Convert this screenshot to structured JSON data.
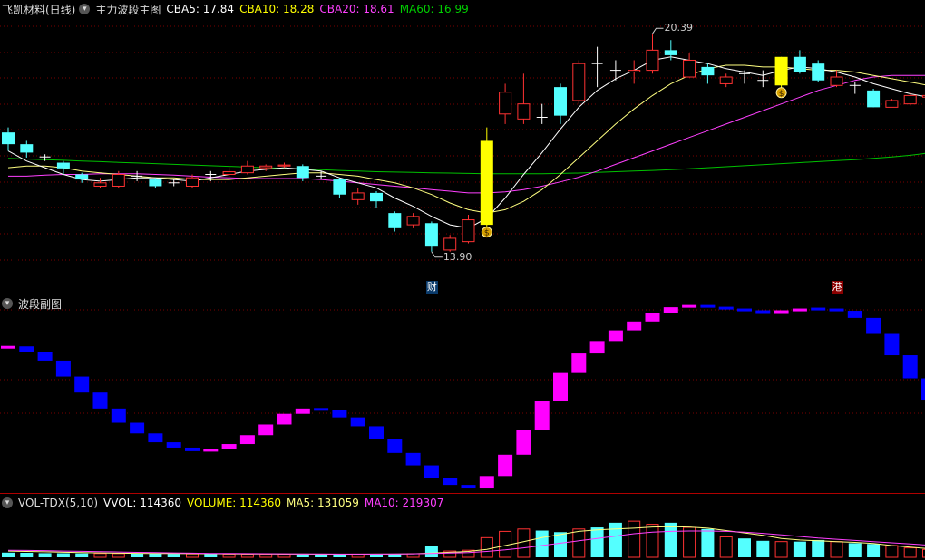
{
  "main_header": {
    "title": "飞凯材料(日线)",
    "indicator_name": "主力波段主图",
    "cba5": "CBA5: 17.84",
    "cba10": "CBA10: 18.28",
    "cba20": "CBA20: 18.61",
    "ma60": "MA60: 16.99"
  },
  "sub_header": {
    "title": "波段副图"
  },
  "vol_header": {
    "title": "VOL-TDX(5,10)",
    "vvol": "VVOL: 114360",
    "volume": "VOLUME: 114360",
    "ma5": "MA5: 131059",
    "ma10": "MA10: 219307"
  },
  "annotations": {
    "high_label": "20.39",
    "low_label": "13.90",
    "tag_cai": "财",
    "tag_gang": "港",
    "money_icon": "$"
  },
  "colors": {
    "up": "#ff3232",
    "down": "#54ffff",
    "signal": "#ffff00",
    "ma5": "#ffffff",
    "ma10": "#ffff80",
    "ma20": "#ff40ff",
    "ma60": "#00c000",
    "wave_up": "#ff00ff",
    "wave_down": "#0000ff",
    "grid": "#7a0000"
  },
  "chart_data": [
    {
      "type": "candlestick",
      "ylim": [
        13.3,
        20.8
      ],
      "candles": [
        {
          "o": 17.1,
          "c": 17.45,
          "h": 17.6,
          "l": 16.9,
          "k": "down"
        },
        {
          "o": 17.1,
          "c": 16.85,
          "h": 17.2,
          "l": 16.7,
          "k": "down"
        },
        {
          "o": 16.72,
          "c": 16.72,
          "h": 16.8,
          "l": 16.6,
          "k": "cross"
        },
        {
          "o": 16.55,
          "c": 16.38,
          "h": 16.6,
          "l": 16.2,
          "k": "down"
        },
        {
          "o": 16.2,
          "c": 16.05,
          "h": 16.25,
          "l": 15.95,
          "k": "down"
        },
        {
          "o": 15.95,
          "c": 15.85,
          "h": 16.1,
          "l": 15.8,
          "k": "up"
        },
        {
          "o": 15.85,
          "c": 16.2,
          "h": 16.3,
          "l": 15.8,
          "k": "up"
        },
        {
          "o": 16.15,
          "c": 16.15,
          "h": 16.3,
          "l": 16.0,
          "k": "cross"
        },
        {
          "o": 16.05,
          "c": 15.85,
          "h": 16.1,
          "l": 15.8,
          "k": "down"
        },
        {
          "o": 15.95,
          "c": 15.95,
          "h": 16.05,
          "l": 15.85,
          "k": "cross"
        },
        {
          "o": 15.85,
          "c": 16.1,
          "h": 16.2,
          "l": 15.8,
          "k": "up"
        },
        {
          "o": 16.2,
          "c": 16.2,
          "h": 16.3,
          "l": 16.0,
          "k": "cross"
        },
        {
          "o": 16.2,
          "c": 16.28,
          "h": 16.4,
          "l": 16.1,
          "k": "up"
        },
        {
          "o": 16.25,
          "c": 16.45,
          "h": 16.6,
          "l": 16.2,
          "k": "up"
        },
        {
          "o": 16.4,
          "c": 16.45,
          "h": 16.5,
          "l": 16.3,
          "k": "up"
        },
        {
          "o": 16.45,
          "c": 16.48,
          "h": 16.55,
          "l": 16.4,
          "k": "up"
        },
        {
          "o": 16.45,
          "c": 16.1,
          "h": 16.5,
          "l": 16.0,
          "k": "down"
        },
        {
          "o": 16.15,
          "c": 16.15,
          "h": 16.3,
          "l": 16.05,
          "k": "cross"
        },
        {
          "o": 16.05,
          "c": 15.6,
          "h": 16.1,
          "l": 15.5,
          "k": "down"
        },
        {
          "o": 15.45,
          "c": 15.65,
          "h": 15.8,
          "l": 15.3,
          "k": "up"
        },
        {
          "o": 15.65,
          "c": 15.4,
          "h": 15.7,
          "l": 15.2,
          "k": "down"
        },
        {
          "o": 15.05,
          "c": 14.6,
          "h": 15.1,
          "l": 14.5,
          "k": "down"
        },
        {
          "o": 14.7,
          "c": 14.95,
          "h": 15.05,
          "l": 14.6,
          "k": "up"
        },
        {
          "o": 14.75,
          "c": 14.05,
          "h": 14.8,
          "l": 13.9,
          "k": "down"
        },
        {
          "o": 13.95,
          "c": 14.3,
          "h": 14.4,
          "l": 13.9,
          "k": "up"
        },
        {
          "o": 14.2,
          "c": 14.85,
          "h": 15.0,
          "l": 14.15,
          "k": "up"
        },
        {
          "o": 14.7,
          "c": 17.2,
          "h": 17.6,
          "l": 14.65,
          "k": "signal"
        },
        {
          "o": 18.0,
          "c": 18.65,
          "h": 18.9,
          "l": 17.7,
          "k": "up"
        },
        {
          "o": 17.85,
          "c": 18.3,
          "h": 19.2,
          "l": 17.7,
          "k": "up"
        },
        {
          "o": 17.9,
          "c": 17.9,
          "h": 18.3,
          "l": 17.7,
          "k": "cross"
        },
        {
          "o": 18.8,
          "c": 17.95,
          "h": 18.9,
          "l": 17.7,
          "k": "down"
        },
        {
          "o": 18.4,
          "c": 19.5,
          "h": 19.6,
          "l": 18.3,
          "k": "up"
        },
        {
          "o": 19.5,
          "c": 19.5,
          "h": 20.0,
          "l": 18.8,
          "k": "cross"
        },
        {
          "o": 19.3,
          "c": 19.3,
          "h": 19.6,
          "l": 19.0,
          "k": "cross"
        },
        {
          "o": 19.25,
          "c": 19.3,
          "h": 19.6,
          "l": 18.9,
          "k": "up"
        },
        {
          "o": 19.3,
          "c": 19.9,
          "h": 20.39,
          "l": 19.2,
          "k": "up"
        },
        {
          "o": 19.9,
          "c": 19.75,
          "h": 20.2,
          "l": 19.6,
          "k": "down"
        },
        {
          "o": 19.6,
          "c": 19.1,
          "h": 19.8,
          "l": 19.1,
          "k": "up"
        },
        {
          "o": 19.4,
          "c": 19.15,
          "h": 19.5,
          "l": 18.9,
          "k": "down"
        },
        {
          "o": 19.1,
          "c": 18.9,
          "h": 19.2,
          "l": 18.8,
          "k": "up"
        },
        {
          "o": 19.2,
          "c": 19.2,
          "h": 19.3,
          "l": 18.9,
          "k": "cross"
        },
        {
          "o": 19.0,
          "c": 19.0,
          "h": 19.3,
          "l": 18.8,
          "k": "cross"
        },
        {
          "o": 18.85,
          "c": 19.7,
          "h": 19.7,
          "l": 18.65,
          "k": "signal"
        },
        {
          "o": 19.7,
          "c": 19.25,
          "h": 19.9,
          "l": 19.2,
          "k": "down"
        },
        {
          "o": 19.5,
          "c": 19.0,
          "h": 19.6,
          "l": 18.95,
          "k": "down"
        },
        {
          "o": 18.85,
          "c": 19.1,
          "h": 19.3,
          "l": 18.8,
          "k": "up"
        },
        {
          "o": 18.85,
          "c": 18.85,
          "h": 18.95,
          "l": 18.6,
          "k": "cross"
        },
        {
          "o": 18.7,
          "c": 18.2,
          "h": 18.75,
          "l": 18.2,
          "k": "down"
        },
        {
          "o": 18.2,
          "c": 18.4,
          "h": 18.45,
          "l": 18.2,
          "k": "up"
        },
        {
          "o": 18.3,
          "c": 18.55,
          "h": 18.65,
          "l": 18.25,
          "k": "up"
        },
        {
          "o": 18.5,
          "c": 18.55,
          "h": 19.0,
          "l": 18.4,
          "k": "up"
        },
        {
          "o": 18.5,
          "c": 18.05,
          "h": 18.6,
          "l": 17.85,
          "k": "down"
        }
      ],
      "series": [
        {
          "name": "CBA5",
          "color": "#ffffff",
          "values": [
            16.9,
            16.6,
            16.4,
            16.2,
            16.05,
            16.0,
            16.05,
            16.1,
            16.1,
            16.05,
            16.0,
            16.1,
            16.2,
            16.3,
            16.35,
            16.4,
            16.35,
            16.3,
            16.1,
            15.95,
            15.8,
            15.5,
            15.25,
            14.95,
            14.7,
            14.6,
            14.9,
            15.5,
            16.2,
            16.85,
            17.55,
            18.2,
            18.7,
            19.05,
            19.3,
            19.6,
            19.7,
            19.6,
            19.5,
            19.35,
            19.25,
            19.15,
            19.3,
            19.4,
            19.35,
            19.25,
            19.1,
            18.9,
            18.75,
            18.6,
            18.5,
            18.35
          ]
        },
        {
          "name": "CBA10",
          "color": "#ffff80",
          "values": [
            16.4,
            16.45,
            16.45,
            16.4,
            16.3,
            16.25,
            16.2,
            16.15,
            16.1,
            16.1,
            16.05,
            16.05,
            16.05,
            16.1,
            16.15,
            16.2,
            16.25,
            16.25,
            16.2,
            16.15,
            16.05,
            15.95,
            15.8,
            15.6,
            15.35,
            15.15,
            15.05,
            15.15,
            15.4,
            15.75,
            16.2,
            16.7,
            17.2,
            17.7,
            18.15,
            18.55,
            18.9,
            19.15,
            19.35,
            19.45,
            19.45,
            19.4,
            19.4,
            19.35,
            19.3,
            19.3,
            19.25,
            19.15,
            19.05,
            18.95,
            18.85,
            18.75
          ]
        },
        {
          "name": "CBA20",
          "color": "#ff40ff",
          "values": [
            16.15,
            16.15,
            16.18,
            16.2,
            16.2,
            16.22,
            16.22,
            16.22,
            16.2,
            16.18,
            16.15,
            16.12,
            16.1,
            16.08,
            16.08,
            16.08,
            16.08,
            16.05,
            16.0,
            15.95,
            15.9,
            15.85,
            15.8,
            15.75,
            15.7,
            15.65,
            15.65,
            15.68,
            15.75,
            15.85,
            15.98,
            16.12,
            16.3,
            16.5,
            16.7,
            16.9,
            17.1,
            17.3,
            17.5,
            17.7,
            17.9,
            18.1,
            18.3,
            18.5,
            18.7,
            18.85,
            19.0,
            19.1,
            19.15,
            19.15,
            19.15,
            19.15
          ]
        },
        {
          "name": "MA60",
          "color": "#00c000",
          "values": [
            16.68,
            16.66,
            16.64,
            16.62,
            16.6,
            16.58,
            16.56,
            16.54,
            16.52,
            16.5,
            16.48,
            16.46,
            16.44,
            16.42,
            16.4,
            16.38,
            16.36,
            16.34,
            16.32,
            16.3,
            16.28,
            16.27,
            16.26,
            16.25,
            16.24,
            16.23,
            16.22,
            16.22,
            16.22,
            16.22,
            16.23,
            16.24,
            16.26,
            16.28,
            16.3,
            16.32,
            16.34,
            16.37,
            16.4,
            16.43,
            16.46,
            16.49,
            16.52,
            16.55,
            16.58,
            16.61,
            16.64,
            16.68,
            16.72,
            16.77,
            16.84,
            16.99
          ]
        }
      ]
    },
    {
      "type": "bar",
      "name": "波段副图",
      "ylim": [
        0,
        100
      ],
      "values": [
        80,
        81,
        78,
        73,
        64,
        55,
        46,
        38,
        32,
        27,
        24,
        22,
        23,
        26,
        31,
        37,
        43,
        46,
        45,
        41,
        36,
        29,
        21,
        14,
        7,
        3,
        1,
        8,
        20,
        34,
        50,
        66,
        77,
        84,
        90,
        95,
        100,
        103,
        104,
        103,
        102,
        101,
        100,
        101,
        102,
        102,
        101,
        97,
        88,
        76,
        63,
        51,
        40,
        32
      ]
    },
    {
      "type": "bar",
      "name": "VOL-TDX(5,10)",
      "ylim": [
        0,
        60000
      ],
      "values": [
        6000,
        5800,
        5300,
        5200,
        5000,
        4900,
        4800,
        4600,
        4700,
        4500,
        4400,
        4200,
        4100,
        4000,
        3900,
        3800,
        3900,
        3900,
        4000,
        4100,
        3900,
        4200,
        4600,
        14000,
        8000,
        9000,
        25000,
        33000,
        36000,
        34000,
        32000,
        36000,
        38000,
        44000,
        46000,
        42000,
        44000,
        38000,
        36000,
        26000,
        24000,
        21000,
        20000,
        20000,
        22000,
        20000,
        18000,
        17000,
        15000,
        12000,
        10000,
        11000,
        10000,
        9500
      ],
      "series": [
        {
          "name": "MA5",
          "color": "#ffff80",
          "values": [
            8000,
            7500,
            7000,
            6500,
            6000,
            5600,
            5300,
            5100,
            5000,
            4900,
            4700,
            4600,
            4500,
            4400,
            4300,
            4200,
            4100,
            4050,
            4000,
            4050,
            4100,
            4200,
            4500,
            5500,
            6500,
            7500,
            10000,
            15000,
            20000,
            25000,
            29000,
            33000,
            35000,
            36000,
            37000,
            38500,
            39000,
            38500,
            37000,
            34000,
            31000,
            28000,
            24000,
            22000,
            21000,
            20000,
            19000,
            17500,
            15000,
            13000,
            11000,
            10500,
            10000,
            9500
          ]
        },
        {
          "name": "MA10",
          "color": "#ff40ff",
          "values": [
            9000,
            8800,
            8500,
            8000,
            7600,
            7200,
            6800,
            6400,
            6000,
            5600,
            5300,
            5000,
            4800,
            4700,
            4600,
            4500,
            4400,
            4300,
            4200,
            4200,
            4200,
            4300,
            4500,
            5000,
            5500,
            6000,
            7500,
            9500,
            12000,
            15000,
            18000,
            21000,
            24000,
            27000,
            30000,
            32000,
            33000,
            33500,
            33500,
            33000,
            32000,
            30500,
            28500,
            26500,
            24500,
            23000,
            21500,
            20000,
            18500,
            17000,
            15500,
            14000,
            12500,
            11500
          ]
        }
      ]
    }
  ]
}
